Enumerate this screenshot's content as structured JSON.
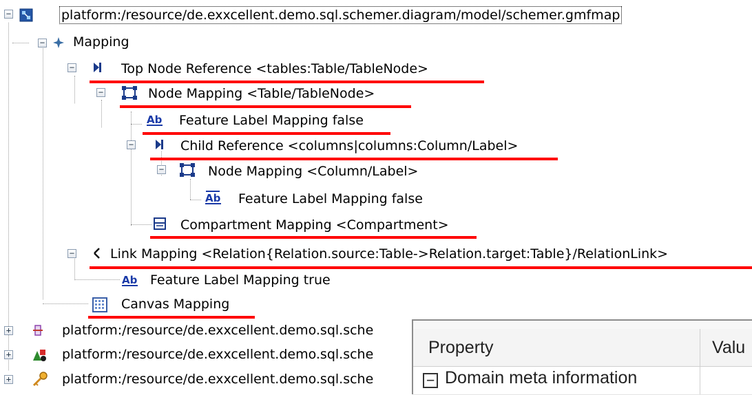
{
  "tree": {
    "root_label": "platform:/resource/de.exxcellent.demo.sql.schemer.diagram/model/schemer.gmfmap",
    "mapping_label": "Mapping",
    "top_node_reference": "Top Node Reference <tables:Table/TableNode>",
    "node_mapping_table": "Node Mapping <Table/TableNode>",
    "feature_label_mapping_1": "Feature Label Mapping false",
    "child_reference": "Child Reference <columns|columns:Column/Label>",
    "node_mapping_column": "Node Mapping <Column/Label>",
    "feature_label_mapping_2": "Feature Label Mapping false",
    "compartment_mapping": "Compartment Mapping <Compartment>",
    "link_mapping": "Link Mapping <Relation{Relation.source:Table->Relation.target:Table}/RelationLink>",
    "feature_label_mapping_3": "Feature Label Mapping true",
    "canvas_mapping": "Canvas Mapping",
    "other_resource_1": "platform:/resource/de.exxcellent.demo.sql.sche",
    "other_resource_2": "platform:/resource/de.exxcellent.demo.sql.sche",
    "other_resource_3": "platform:/resource/de.exxcellent.demo.sql.sche",
    "expanded_symbol": "−",
    "collapsed_symbol": "+"
  },
  "properties": {
    "col_property": "Property",
    "col_value": "Valu",
    "group_domain_meta": "Domain meta information",
    "group_toggle": "−"
  },
  "colors": {
    "underline": "#ff0000"
  }
}
